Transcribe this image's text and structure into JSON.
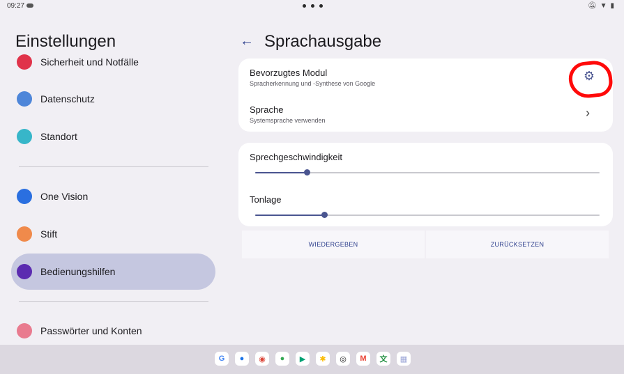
{
  "status_bar": {
    "time": "09:27"
  },
  "left_panel": {
    "title": "Einstellungen",
    "items": [
      {
        "label": "Sicherheit und Notfälle",
        "icon": "asterisk-icon",
        "color": "#e0334a"
      },
      {
        "label": "Datenschutz",
        "icon": "eye-icon",
        "color": "#4e86d9"
      },
      {
        "label": "Standort",
        "icon": "location-pin-icon",
        "color": "#37b6c9"
      },
      {
        "label": "One Vision",
        "icon": "grid-icon",
        "color": "#2a6fe0"
      },
      {
        "label": "Stift",
        "icon": "pen-icon",
        "color": "#f08a4b"
      },
      {
        "label": "Bedienungshilfen",
        "icon": "accessibility-icon",
        "color": "#5b2bb0"
      },
      {
        "label": "Passwörter und Konten",
        "icon": "person-card-icon",
        "color": "#e97b8f"
      }
    ]
  },
  "main": {
    "title": "Sprachausgabe",
    "engine": {
      "title": "Bevorzugtes Modul",
      "subtitle": "Spracherkennung und -Synthese von Google"
    },
    "language": {
      "title": "Sprache",
      "subtitle": "Systemsprache verwenden"
    },
    "speech_rate": {
      "label": "Sprechgeschwindigkeit",
      "level": 0.15
    },
    "pitch": {
      "label": "Tonlage",
      "level": 0.2
    },
    "buttons": {
      "play": "WIEDERGEBEN",
      "reset": "ZURÜCKSETZEN"
    }
  },
  "dock": {
    "apps": [
      {
        "name": "google-icon",
        "glyph": "G",
        "color": "#4285f4"
      },
      {
        "name": "messages-icon",
        "glyph": "●",
        "color": "#1a73e8"
      },
      {
        "name": "chrome-icon",
        "glyph": "◉",
        "color": "#db4437"
      },
      {
        "name": "assistant-icon",
        "glyph": "●",
        "color": "#34a853"
      },
      {
        "name": "play-store-icon",
        "glyph": "▶",
        "color": "#00a173"
      },
      {
        "name": "photos-icon",
        "glyph": "✱",
        "color": "#fbbc05"
      },
      {
        "name": "camera-icon",
        "glyph": "◎",
        "color": "#222222"
      },
      {
        "name": "gmail-icon",
        "glyph": "M",
        "color": "#ea4335"
      },
      {
        "name": "translate-icon",
        "glyph": "文",
        "color": "#1e8e3e"
      },
      {
        "name": "app-drawer-icon",
        "glyph": "▦",
        "color": "#9aa4d6"
      }
    ]
  }
}
